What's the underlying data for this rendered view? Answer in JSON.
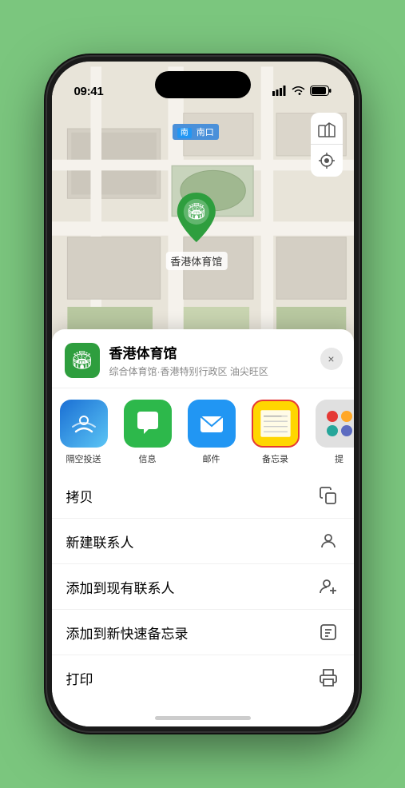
{
  "status_bar": {
    "time": "09:41",
    "signal_icon": "▌▌▌",
    "wifi_icon": "wifi",
    "battery_icon": "battery"
  },
  "map": {
    "road_label": "南口",
    "location_name": "香港体育馆",
    "controls": {
      "map_type_label": "map",
      "location_label": "location"
    }
  },
  "bottom_sheet": {
    "place": {
      "name": "香港体育馆",
      "subtitle": "综合体育馆·香港特别行政区 油尖旺区",
      "avatar_icon": "🏟"
    },
    "close_label": "×",
    "share_apps": [
      {
        "id": "airdrop",
        "label": "隔空投送",
        "type": "airdrop"
      },
      {
        "id": "messages",
        "label": "信息",
        "type": "messages"
      },
      {
        "id": "mail",
        "label": "邮件",
        "type": "mail"
      },
      {
        "id": "notes",
        "label": "备忘录",
        "type": "notes"
      },
      {
        "id": "more",
        "label": "提",
        "type": "more"
      }
    ],
    "actions": [
      {
        "id": "copy",
        "label": "拷贝",
        "icon": "copy"
      },
      {
        "id": "new-contact",
        "label": "新建联系人",
        "icon": "person"
      },
      {
        "id": "add-existing",
        "label": "添加到现有联系人",
        "icon": "person-add"
      },
      {
        "id": "add-quick-note",
        "label": "添加到新快速备忘录",
        "icon": "note"
      },
      {
        "id": "print",
        "label": "打印",
        "icon": "print"
      }
    ]
  }
}
